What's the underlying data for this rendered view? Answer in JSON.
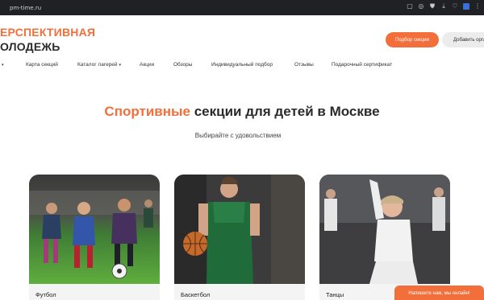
{
  "browser": {
    "url": "pm-time.ru",
    "icons": [
      "bookmark-icon",
      "screenshot-icon",
      "shield-icon",
      "download-icon",
      "favorite-icon",
      "extension-icon",
      "menu-icon"
    ]
  },
  "header": {
    "logo_line1": "ЕРСПЕКТИВНАЯ",
    "logo_line2": "ОЛОДЕЖЬ",
    "primary_button": "Подбор секции",
    "secondary_button": "Добавить орга",
    "brand_color": "#f26f3b"
  },
  "nav": {
    "items": [
      {
        "label": "Карта секций"
      },
      {
        "label": "Каталог лагерей"
      },
      {
        "label": "Акции"
      },
      {
        "label": "Обзоры"
      },
      {
        "label": "Индивидуальный подбор"
      },
      {
        "label": "Отзывы"
      },
      {
        "label": "Подарочный сертификат"
      }
    ]
  },
  "hero": {
    "title_accent": "Спортивные",
    "title_rest": " секции для детей в Москве",
    "subtitle": "Выбирайте с удовольствием"
  },
  "cards": [
    {
      "label": "Футбол"
    },
    {
      "label": "Баскетбол"
    },
    {
      "label": "Танцы"
    }
  ],
  "chat": {
    "label": "Напишите нам, мы онлайн!"
  }
}
